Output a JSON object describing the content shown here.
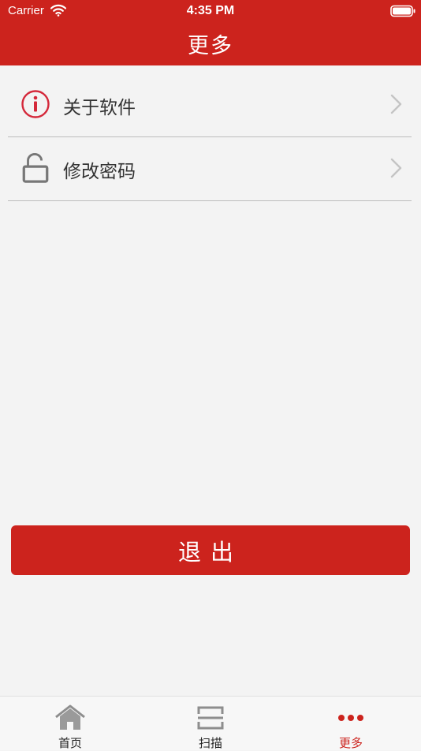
{
  "status_bar": {
    "carrier": "Carrier",
    "time": "4:35 PM"
  },
  "nav": {
    "title": "更多"
  },
  "menu": {
    "items": [
      {
        "label": "关于软件",
        "icon": "info-icon"
      },
      {
        "label": "修改密码",
        "icon": "unlock-icon"
      }
    ]
  },
  "logout": {
    "label": "退出"
  },
  "tabs": [
    {
      "label": "首页",
      "icon": "home-icon",
      "active": false
    },
    {
      "label": "扫描",
      "icon": "scan-icon",
      "active": false
    },
    {
      "label": "更多",
      "icon": "more-icon",
      "active": true
    }
  ],
  "colors": {
    "brand": "#cc231d",
    "background": "#f3f3f3",
    "inactive_icon": "#8e8e8e"
  }
}
